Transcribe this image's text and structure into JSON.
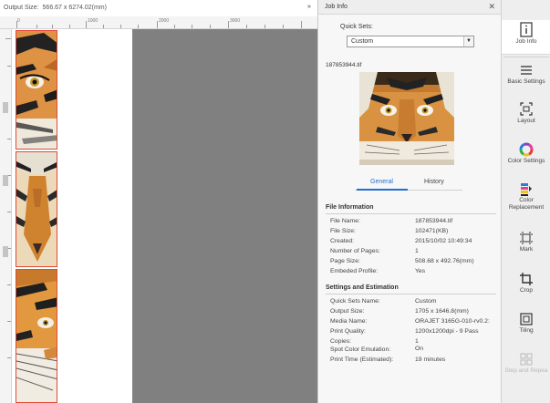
{
  "preview": {
    "output_size_label": "Output Size:",
    "output_size_value": "566.67 x 6274.02(mm)",
    "collapse_glyph": "»",
    "ruler_labels": [
      "0",
      "1000",
      "2000",
      "3000"
    ]
  },
  "job_info": {
    "title": "Job Info",
    "close_glyph": "✕",
    "quick_sets_label": "Quick Sets:",
    "quick_sets_value": "Custom",
    "file_name_top": "187853944.tif",
    "tabs": {
      "general": "General",
      "history": "History"
    },
    "file_information": {
      "title": "File Information",
      "rows": [
        {
          "k": "File Name:",
          "v": "187853944.tif"
        },
        {
          "k": "File Size:",
          "v": "102471(KB)"
        },
        {
          "k": "Created:",
          "v": "2015/10/02 10:49:34"
        },
        {
          "k": "Number of Pages:",
          "v": "1"
        },
        {
          "k": "Page Size:",
          "v": "508.68 x 492.76(mm)"
        },
        {
          "k": "Embeded Profile:",
          "v": "Yes"
        }
      ]
    },
    "settings": {
      "title": "Settings and Estimation",
      "rows": [
        {
          "k": "Quick Sets Name:",
          "v": "Custom"
        },
        {
          "k": "Output Size:",
          "v": "1705 x 1646.8(mm)"
        },
        {
          "k": "Media Name:",
          "v": "ORAJET 3165G-010-rv0.2:"
        },
        {
          "k": "Print Quality:",
          "v": "1200x1200dpi - 9 Pass"
        },
        {
          "k": "Copies:",
          "v": "1"
        },
        {
          "k": "Spot Color Emulation:",
          "v": "On"
        },
        {
          "k": "Print Time (Estimated):",
          "v": "19 minutes"
        }
      ]
    }
  },
  "rail": {
    "job_info": "Job Info",
    "basic_settings": "Basic Settings",
    "layout": "Layout",
    "color_settings": "Color Settings",
    "color_replacement_1": "Color",
    "color_replacement_2": "Replacement",
    "mark": "Mark",
    "crop": "Crop",
    "tiling": "Tiling",
    "step_and_repeat": "Step and Repea"
  }
}
